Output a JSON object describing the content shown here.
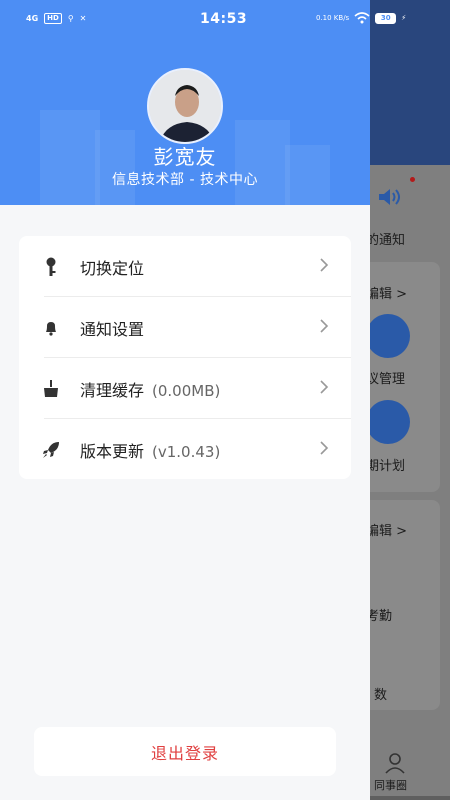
{
  "status_bar": {
    "network": "4G",
    "hd": "HD",
    "time": "14:53",
    "speed": "0.10 KB/s",
    "battery": "30"
  },
  "profile": {
    "name": "彭宽友",
    "department": "信息技术部 - 技术中心"
  },
  "menu": [
    {
      "label": "切换定位",
      "extra": "",
      "icon": "key-icon"
    },
    {
      "label": "通知设置",
      "extra": "",
      "icon": "bell-icon"
    },
    {
      "label": "清理缓存",
      "extra": "(0.00MB)",
      "icon": "broom-icon"
    },
    {
      "label": "版本更新",
      "extra": "(v1.0.43)",
      "icon": "rocket-icon"
    }
  ],
  "logout_label": "退出登录",
  "background": {
    "notice_text": "的通知",
    "edit_label_1": "编辑 >",
    "meeting_label": "议管理",
    "plan_label": "期计划",
    "edit_label_2": "编辑 >",
    "attendance_label": "考勤",
    "count_label": "数",
    "tab_label": "同事圈"
  },
  "colors": {
    "header_blue": "#4d8ef4",
    "logout_red": "#e04040"
  }
}
